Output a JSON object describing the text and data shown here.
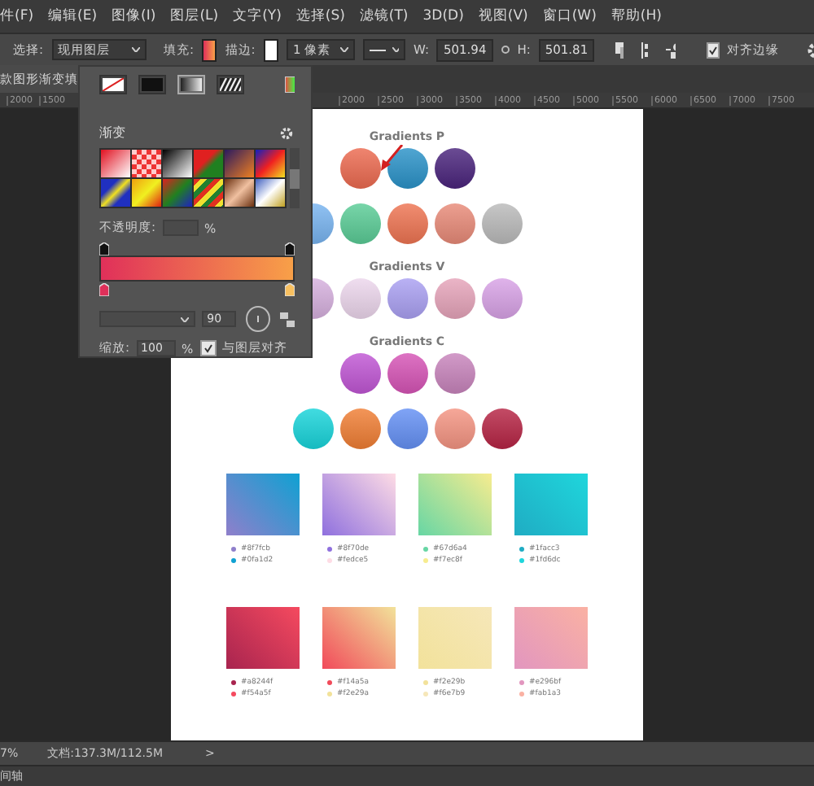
{
  "menu_bar": {
    "items": [
      "件(F)",
      "编辑(E)",
      "图像(I)",
      "图层(L)",
      "文字(Y)",
      "选择(S)",
      "滤镜(T)",
      "3D(D)",
      "视图(V)",
      "窗口(W)",
      "帮助(H)"
    ]
  },
  "options_bar": {
    "select_label": "选择:",
    "select_value": "现用图层",
    "fill_label": "填充:",
    "stroke_label": "描边:",
    "stroke_width": "1 像素",
    "w_label": "W:",
    "w_value": "501.94",
    "h_label": "H:",
    "h_value": "501.81",
    "align_edges": {
      "label": "对齐边缘",
      "checked": true
    }
  },
  "document_tab": {
    "title": "款图形渐变填"
  },
  "ruler": {
    "left_ticks": [
      "2000",
      "1500"
    ],
    "right_ticks": [
      "2000",
      "2500",
      "3000",
      "3500",
      "4000",
      "4500",
      "5000",
      "5500",
      "6000",
      "6500",
      "7000",
      "7500"
    ]
  },
  "gradient_panel": {
    "fill_types": [
      {
        "kind": "none",
        "selected": false
      },
      {
        "kind": "solid",
        "selected": false
      },
      {
        "kind": "gradient",
        "selected": true
      },
      {
        "kind": "pattern",
        "selected": false
      }
    ],
    "title": "渐变",
    "opacity_label": "不透明度:",
    "opacity_unit": "%",
    "angle": "90",
    "scale_label": "缩放:",
    "scale_value": "100",
    "scale_unit": "%",
    "align_layer": {
      "label": "与图层对齐",
      "checked": true
    }
  },
  "document": {
    "sections": [
      {
        "title": "Gradients P",
        "rows": [
          [
            {
              "color": "#ec6a50"
            },
            {
              "color": "#2a92c8"
            },
            {
              "color": "#4a247c"
            }
          ],
          [
            {
              "color": "#78b4f0"
            },
            {
              "color": "#5acc96"
            },
            {
              "color": "#ee7452"
            },
            {
              "color": "#e88a78"
            },
            {
              "color": "#bababa"
            }
          ]
        ]
      },
      {
        "title": "Gradients V",
        "rows": [
          [
            {
              "color": "#d6b0de"
            },
            {
              "color": "#ecd6ec"
            },
            {
              "color": "#aaa0f2"
            },
            {
              "color": "#e6a4ba"
            },
            {
              "color": "#d8a2e6"
            }
          ]
        ]
      },
      {
        "title": "Gradients C",
        "rows": [
          [
            {
              "color": "#c056d4"
            },
            {
              "color": "#d654b6"
            },
            {
              "color": "#c884bc"
            }
          ],
          [
            {
              "color": "#18d4da"
            },
            {
              "color": "#f07e34"
            },
            {
              "color": "#6490f4"
            },
            {
              "color": "#f49482"
            },
            {
              "color": "#b62444"
            }
          ]
        ]
      }
    ],
    "swatch_rows": [
      [
        {
          "labels": [
            {
              "text": "#8f7fcb",
              "color": "#8f7fcb"
            },
            {
              "text": "#0fa1d2",
              "color": "#0fa1d2"
            }
          ]
        },
        {
          "labels": [
            {
              "text": "#8f70de",
              "color": "#8f70de"
            },
            {
              "text": "#fedce5",
              "color": "#fedce5"
            }
          ]
        },
        {
          "labels": [
            {
              "text": "#67d6a4",
              "color": "#67d6a4"
            },
            {
              "text": "#f7ec8f",
              "color": "#f7ec8f"
            }
          ]
        },
        {
          "labels": [
            {
              "text": "#1facc3",
              "color": "#1facc3"
            },
            {
              "text": "#1fd6dc",
              "color": "#1fd6dc"
            }
          ]
        }
      ],
      [
        {
          "labels": [
            {
              "text": "#a8244f",
              "color": "#a8244f"
            },
            {
              "text": "#f54a5f",
              "color": "#f54a5f"
            }
          ]
        },
        {
          "labels": [
            {
              "text": "#f14a5a",
              "color": "#f14a5a"
            },
            {
              "text": "#f2e29a",
              "color": "#f2e29a"
            }
          ]
        },
        {
          "labels": [
            {
              "text": "#f2e29b",
              "color": "#f2e29b"
            },
            {
              "text": "#f6e7b9",
              "color": "#f6e7b9"
            }
          ]
        },
        {
          "labels": [
            {
              "text": "#e296bf",
              "color": "#e296bf"
            },
            {
              "text": "#fab1a3",
              "color": "#fab1a3"
            }
          ]
        }
      ]
    ]
  },
  "status_bar": {
    "zoom": "7%",
    "document_size": "文档:137.3M/112.5M",
    "arrow": ">"
  },
  "timeline": {
    "label": "间轴"
  }
}
